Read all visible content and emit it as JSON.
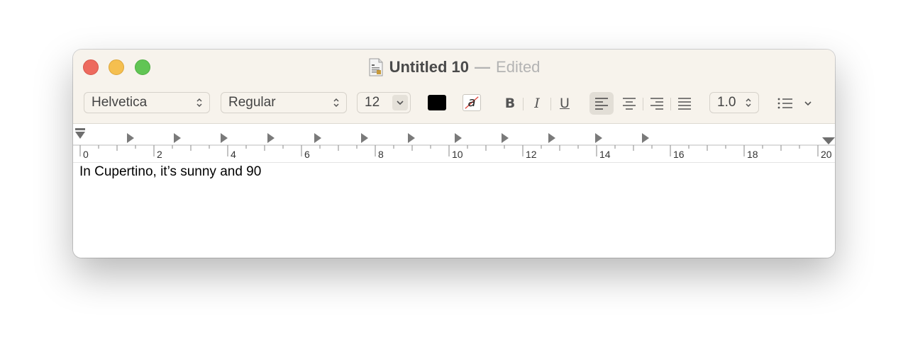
{
  "window": {
    "title": "Untitled 10",
    "separator": "—",
    "status": "Edited"
  },
  "toolbar": {
    "font_family": "Helvetica",
    "font_style": "Regular",
    "font_size": "12",
    "text_color": "#000000",
    "highlight_glyph": "a",
    "bold_label": "B",
    "italic_label": "I",
    "underline_label": "U",
    "alignment_selected": "left",
    "line_spacing": "1.0"
  },
  "ruler": {
    "labels": [
      "0",
      "2",
      "4",
      "6",
      "8",
      "10",
      "12",
      "14",
      "16",
      "18",
      "20"
    ]
  },
  "document": {
    "text": "In Cupertino, it’s sunny and 90"
  },
  "colors": {
    "close": "#ed6a5e",
    "minimize": "#f5bf4f",
    "zoom": "#61c554",
    "titlebar_bg": "#f7f3ec"
  }
}
